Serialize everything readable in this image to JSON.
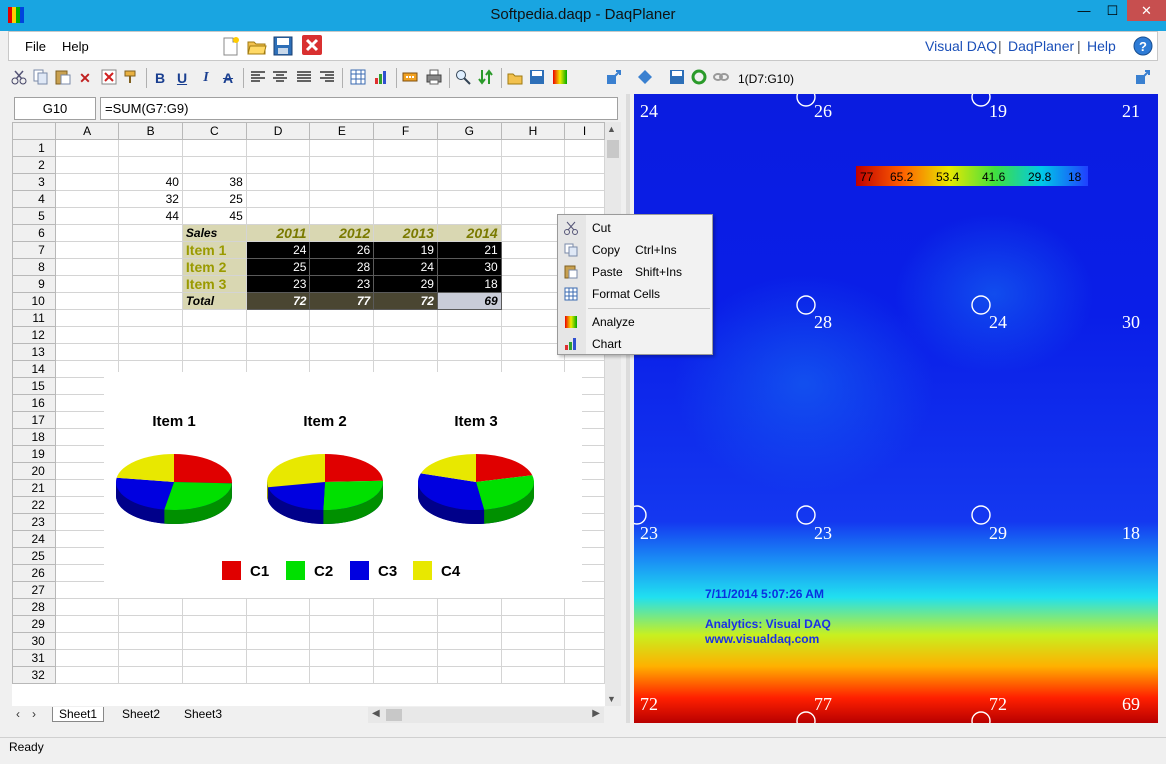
{
  "window": {
    "title": "Softpedia.daqp - DaqPlaner",
    "min": "—",
    "max": "☐",
    "close": "✕"
  },
  "menu": {
    "file": "File",
    "help": "Help"
  },
  "links": {
    "visual_daq": "Visual DAQ",
    "daqplaner": "DaqPlaner",
    "help": "Help",
    "sep": "|"
  },
  "toolbar": {
    "bold": "B",
    "underline": "U",
    "italic": "I",
    "strike": "A"
  },
  "formula": {
    "cell": "G10",
    "expr": "=SUM(G7:G9)"
  },
  "columns": [
    "A",
    "B",
    "C",
    "D",
    "E",
    "F",
    "G",
    "H",
    "I"
  ],
  "rows": [
    "1",
    "2",
    "3",
    "4",
    "5",
    "6",
    "7",
    "8",
    "9",
    "10",
    "11",
    "12",
    "13",
    "14",
    "15",
    "16",
    "17",
    "18",
    "19",
    "20",
    "21",
    "22",
    "23",
    "24",
    "25",
    "26",
    "27",
    "28",
    "29",
    "30",
    "31",
    "32"
  ],
  "sheet": {
    "b3": "40",
    "c3": "38",
    "b4": "32",
    "c4": "25",
    "b5": "44",
    "c5": "45",
    "sales": "Sales",
    "years": [
      "2011",
      "2012",
      "2013",
      "2014"
    ],
    "items": [
      "Item 1",
      "Item 2",
      "Item 3"
    ],
    "total": "Total",
    "table": [
      [
        "24",
        "26",
        "19",
        "21"
      ],
      [
        "25",
        "28",
        "24",
        "30"
      ],
      [
        "23",
        "23",
        "29",
        "18"
      ]
    ],
    "totals": [
      "72",
      "77",
      "72",
      "69"
    ]
  },
  "chart_data": {
    "type": "pie",
    "charts": [
      {
        "title": "Item 1",
        "values": [
          24,
          25,
          23,
          21
        ]
      },
      {
        "title": "Item 2",
        "values": [
          26,
          28,
          23,
          30
        ]
      },
      {
        "title": "Item 3",
        "values": [
          19,
          24,
          29,
          18
        ]
      }
    ],
    "legend": [
      "C1",
      "C2",
      "C3",
      "C4"
    ],
    "colors": [
      "#e00000",
      "#00e000",
      "#0000e0",
      "#e8e800"
    ]
  },
  "tabs": [
    "Sheet1",
    "Sheet2",
    "Sheet3"
  ],
  "context_menu": {
    "cut": "Cut",
    "copy": "Copy",
    "copy_key": "Ctrl+Ins",
    "paste": "Paste",
    "paste_key": "Shift+Ins",
    "format": "Format Cells",
    "analyze": "Analyze",
    "chart": "Chart"
  },
  "right_panel": {
    "range": "1(D7:G10)",
    "top_values": [
      "24",
      "26",
      "19",
      "21"
    ],
    "mid_values": [
      "28",
      "24",
      "30"
    ],
    "low_values": [
      "23",
      "23",
      "29",
      "18"
    ],
    "bottom_values": [
      "72",
      "77",
      "72",
      "69"
    ],
    "scale": [
      "77",
      "65.2",
      "53.4",
      "41.6",
      "29.8",
      "18"
    ],
    "timestamp": "7/11/2014 5:07:26 AM",
    "analytics": "Analytics: Visual DAQ",
    "site": "www.visualdaq.com"
  },
  "status": {
    "text": "Ready"
  }
}
